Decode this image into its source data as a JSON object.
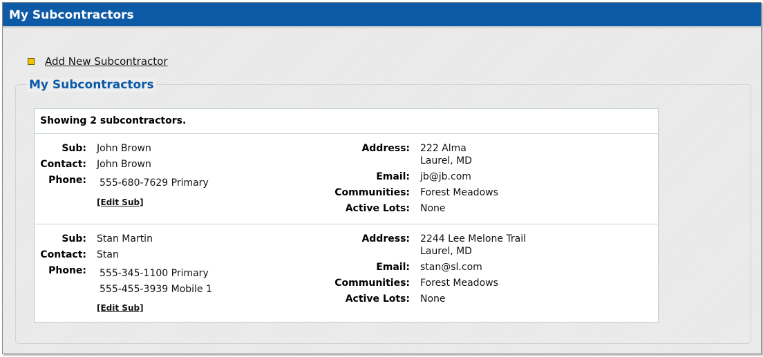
{
  "window": {
    "title": "My Subcontractors"
  },
  "actions": {
    "add_label": "Add New Subcontractor"
  },
  "section": {
    "legend": "My Subcontractors",
    "summary": "Showing 2 subcontractors."
  },
  "labels": {
    "sub": "Sub:",
    "contact": "Contact:",
    "phone": "Phone:",
    "address": "Address:",
    "email": "Email:",
    "communities": "Communities:",
    "active_lots": "Active Lots:",
    "edit": "[Edit Sub]"
  },
  "subs": [
    {
      "sub": "John Brown",
      "contact": "John Brown",
      "phones": [
        "555-680-7629 Primary"
      ],
      "address_line1": "222 Alma",
      "address_line2": "Laurel, MD",
      "email": "jb@jb.com",
      "communities": "Forest Meadows",
      "active_lots": "None"
    },
    {
      "sub": "Stan Martin",
      "contact": "Stan",
      "phones": [
        "555-345-1100 Primary",
        "555-455-3939 Mobile 1"
      ],
      "address_line1": "2244 Lee Melone Trail",
      "address_line2": "Laurel, MD",
      "email": "stan@sl.com",
      "communities": "Forest Meadows",
      "active_lots": "None"
    }
  ],
  "colors": {
    "titlebar": "#0d5aa7",
    "legend": "#0d5aa7",
    "bullet": "#f5c200"
  }
}
